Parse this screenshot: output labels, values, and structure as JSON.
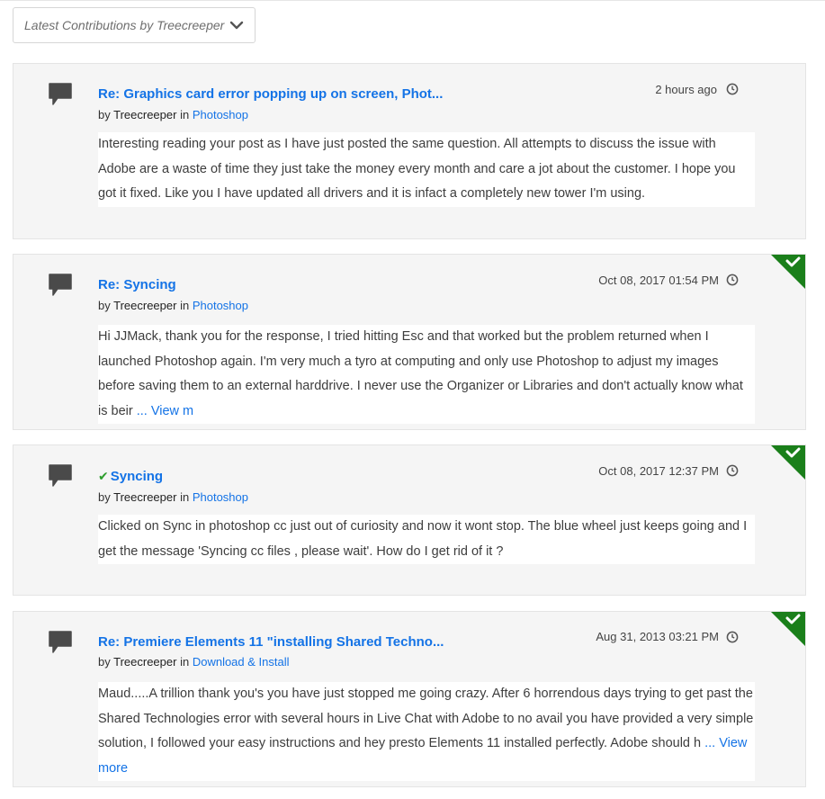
{
  "filter": {
    "label": "Latest Contributions by Treecreeper"
  },
  "icons": {
    "comment": "speech-bubble-icon",
    "clock": "clock-icon",
    "chevron": "chevron-down-icon",
    "solved": "accepted-solution-icon"
  },
  "colors": {
    "link": "#1473e6",
    "solved": "#1a7f1a",
    "card_bg": "#f5f5f5"
  },
  "posts": [
    {
      "title": "Re: Graphics card error popping up on screen, Phot...",
      "by_prefix": "by",
      "author": "Treecreeper",
      "in_word": "in",
      "board": "Photoshop",
      "date": "2 hours ago",
      "solved": false,
      "body": "Interesting reading your post as I have just posted the same question. All attempts to discuss the issue with Adobe are a waste of time they just take the money every month and care a jot about the customer. I hope you got it fixed. Like you I have updated all drivers and it is infact a completely new tower I'm using.",
      "view_more": ""
    },
    {
      "title": "Re: Syncing",
      "by_prefix": "by",
      "author": "Treecreeper",
      "in_word": "in",
      "board": "Photoshop",
      "date": "Oct 08, 2017 01:54 PM",
      "solved": true,
      "body": "Hi JJMack, thank you for the response, I tried hitting Esc and that worked but the problem returned when I launched Photoshop again. I'm very much a tyro at computing and only use Photoshop to adjust my images before saving them to an external harddrive. I never use the Organizer or Libraries and don't actually know what is beir",
      "view_more": "... View m"
    },
    {
      "title": "Syncing",
      "by_prefix": "by",
      "author": "Treecreeper",
      "in_word": "in",
      "board": "Photoshop",
      "date": "Oct 08, 2017 12:37 PM",
      "solved": true,
      "title_check": "✔",
      "body": "Clicked on Sync in photoshop cc just out of curiosity and now it wont stop. The blue wheel just keeps going and I get the message 'Syncing cc files , please wait'. How do I get rid of it ?",
      "view_more": ""
    },
    {
      "title": "Re: Premiere Elements 11 \"installing Shared Techno...",
      "by_prefix": "by",
      "author": "Treecreeper",
      "in_word": "in",
      "board": "Download & Install",
      "date": "Aug 31, 2013 03:21 PM",
      "solved": true,
      "body": "Maud.....A trillion thank you's you have just stopped me going crazy. After 6 horrendous days trying to get past the Shared Technologies error with several hours in Live Chat with Adobe to no avail you have provided a very simple solution, I followed your easy instructions and hey presto Elements 11 installed perfectly. Adobe should h",
      "view_more": "... View more"
    }
  ]
}
